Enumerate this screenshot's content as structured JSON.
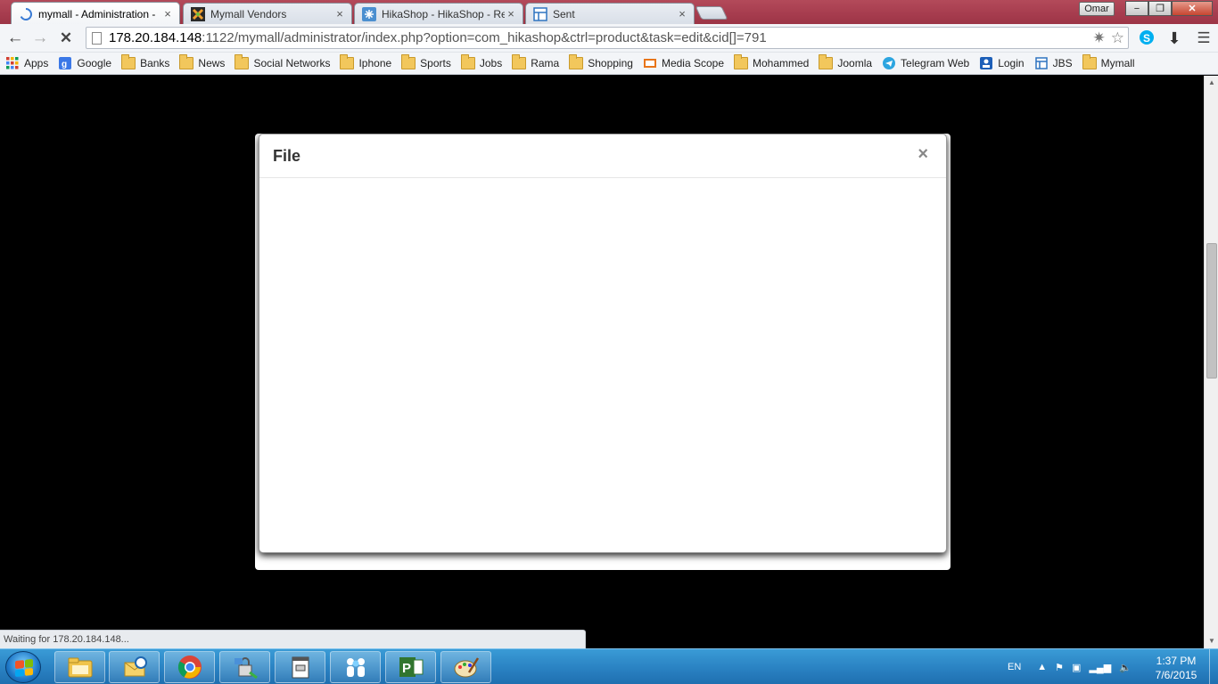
{
  "tabs": [
    {
      "title": "mymall - Administration -",
      "close": "×"
    },
    {
      "title": "Mymall Vendors",
      "close": "×"
    },
    {
      "title": "HikaShop - HikaShop - Re",
      "close": "×"
    },
    {
      "title": "Sent",
      "close": "×"
    }
  ],
  "profile_name": "Omar",
  "window_controls": {
    "minimize": "−",
    "restore": "❐",
    "close": "✕"
  },
  "toolbar": {
    "back": "←",
    "forward": "→",
    "stop": "✕"
  },
  "url": {
    "host": "178.20.184.148",
    "rest": ":1122/mymall/administrator/index.php?option=com_hikashop&ctrl=product&task=edit&cid[]=791"
  },
  "bookmarks": [
    {
      "label": "Apps",
      "icon": "apps-grid-icon"
    },
    {
      "label": "Google",
      "icon": "google-icon"
    },
    {
      "label": "Banks",
      "icon": "folder-icon"
    },
    {
      "label": "News",
      "icon": "folder-icon"
    },
    {
      "label": "Social Networks",
      "icon": "folder-icon"
    },
    {
      "label": "Iphone",
      "icon": "folder-icon"
    },
    {
      "label": "Sports",
      "icon": "folder-icon"
    },
    {
      "label": "Jobs",
      "icon": "folder-icon"
    },
    {
      "label": "Rama",
      "icon": "folder-icon"
    },
    {
      "label": "Shopping",
      "icon": "folder-icon"
    },
    {
      "label": "Media Scope",
      "icon": "media-scope-icon"
    },
    {
      "label": "Mohammed",
      "icon": "folder-icon"
    },
    {
      "label": "Joomla",
      "icon": "folder-icon"
    },
    {
      "label": "Telegram Web",
      "icon": "telegram-icon"
    },
    {
      "label": "Login",
      "icon": "login-icon"
    },
    {
      "label": "JBS",
      "icon": "jbs-icon"
    },
    {
      "label": "Mymall",
      "icon": "folder-icon"
    }
  ],
  "modal": {
    "title": "File",
    "close": "×"
  },
  "status": "Waiting for 178.20.184.148...",
  "tray": {
    "language": "EN",
    "time": "1:37 PM",
    "date": "7/6/2015"
  },
  "colors": {
    "tab_strip": "#a63c4e",
    "taskbar": "#2b84c4",
    "overlay": "#000000"
  }
}
